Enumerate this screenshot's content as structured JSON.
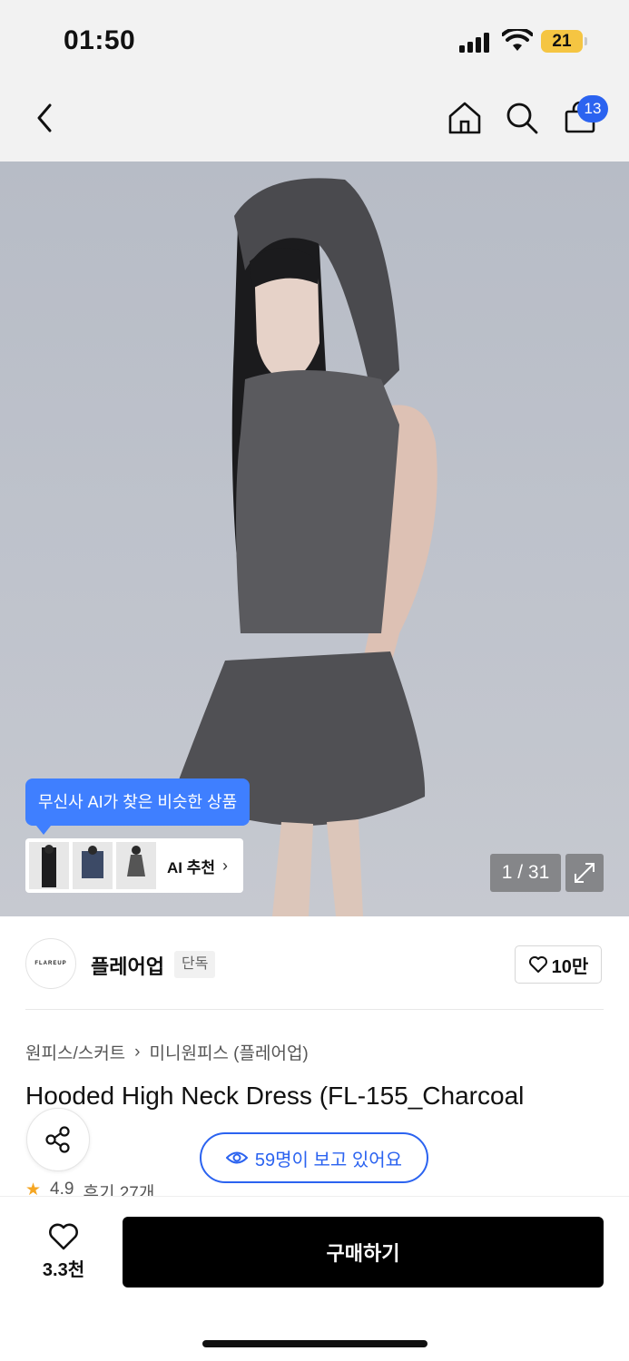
{
  "status": {
    "time": "01:50",
    "battery": "21"
  },
  "header": {
    "cart_count": "13",
    "icons": [
      "back-icon",
      "home-icon",
      "search-icon",
      "cart-icon"
    ]
  },
  "gallery": {
    "ai_tooltip": "무신사 AI가 찾은 비슷한 상품",
    "ai_recommend_label": "AI 추천",
    "counter": "1 / 31"
  },
  "brand": {
    "logo_text": "FLAREUP",
    "name": "플레어업",
    "tag": "단독",
    "likes": "10만"
  },
  "breadcrumb": {
    "category": "원피스/스커트",
    "sep": "›",
    "subcategory": "미니원피스 (플레어업)"
  },
  "product": {
    "title": "Hooded High Neck Dress (FL-155_Charcoal",
    "viewers": "59명이 보고 있어요",
    "rating_peek": "4.9",
    "review_peek": "후기 27개"
  },
  "bottom": {
    "wish_count": "3.3천",
    "buy_label": "구매하기"
  },
  "colors": {
    "accent": "#2b63f0",
    "buy_bg": "#000000",
    "tooltip": "#3f7fff"
  }
}
